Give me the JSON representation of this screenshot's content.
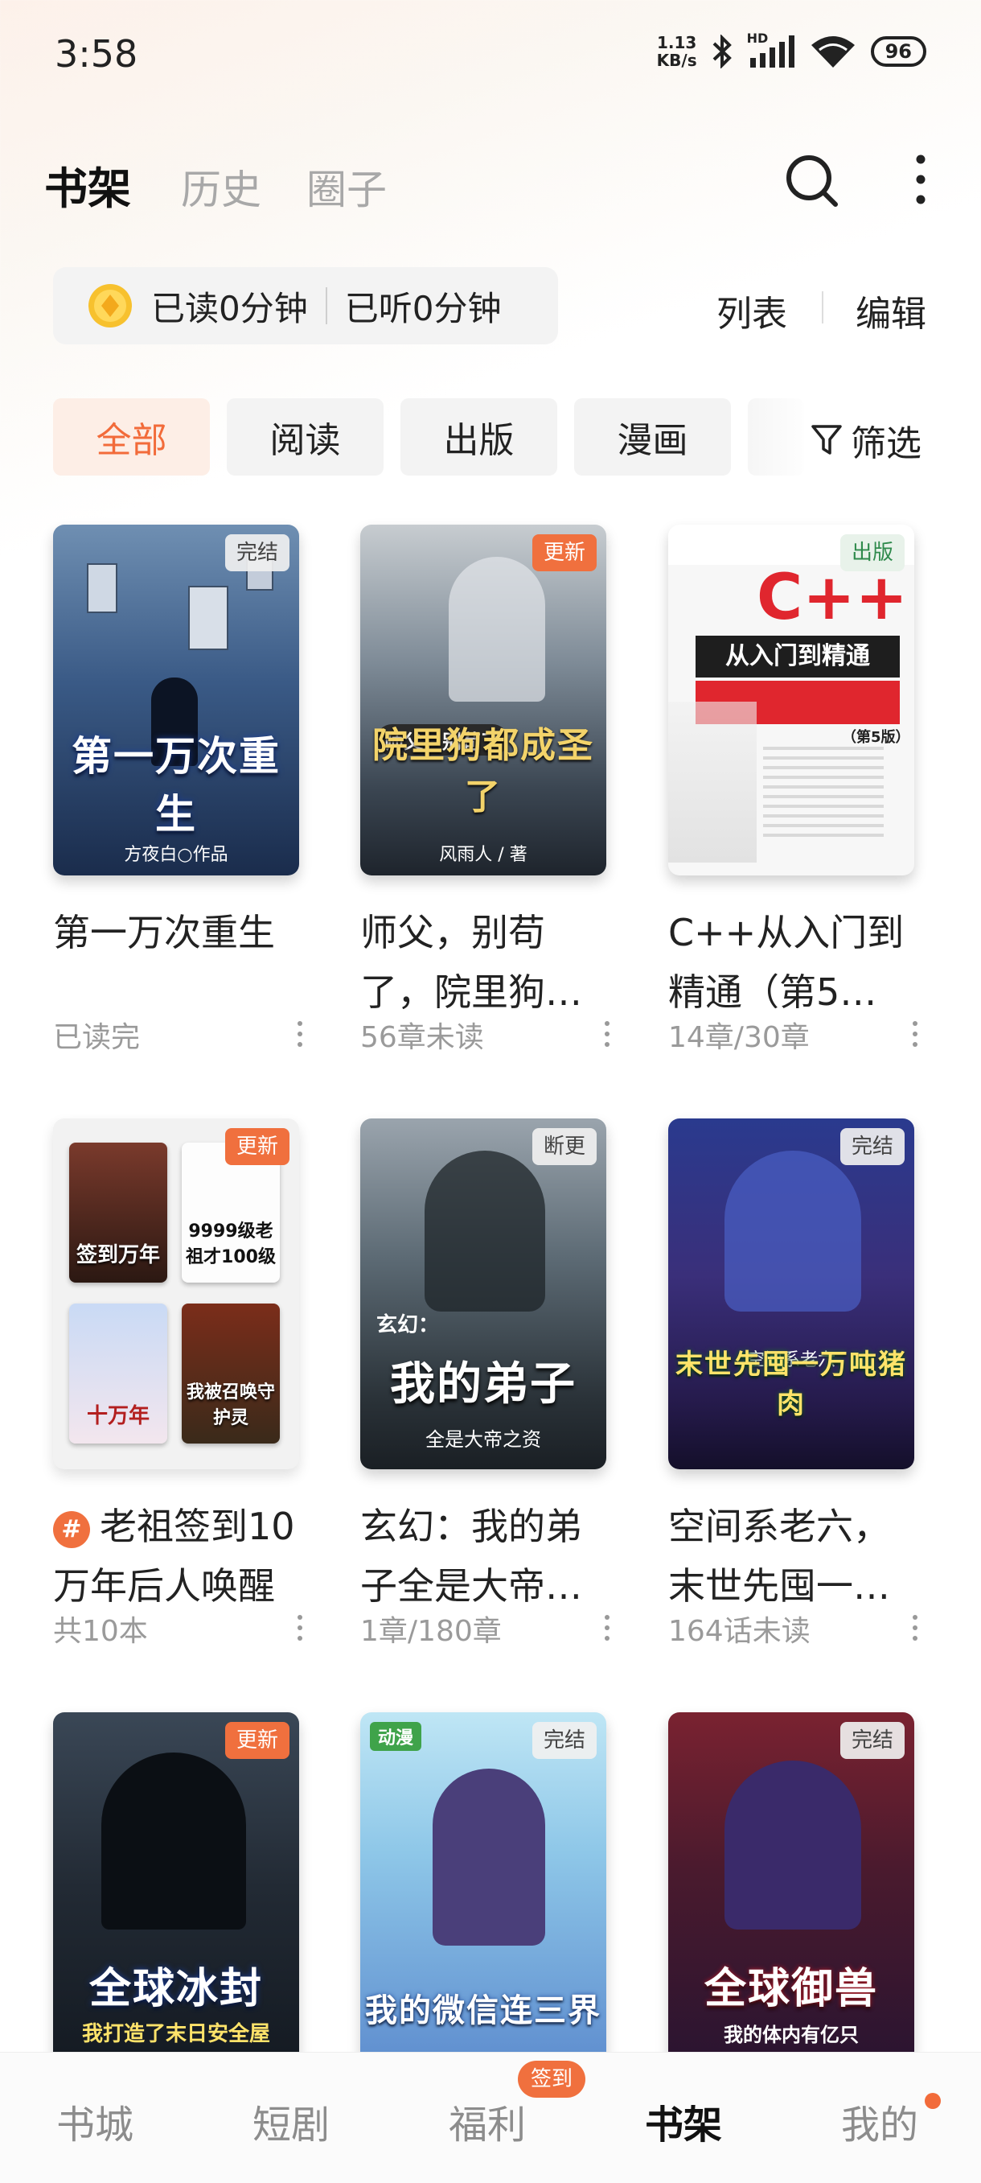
{
  "status_bar": {
    "time": "3:58",
    "net_speed_value": "1.13",
    "net_speed_unit": "KB/s",
    "battery": "96",
    "network_label": "HD"
  },
  "header": {
    "tabs": [
      {
        "label": "书架",
        "active": true
      },
      {
        "label": "历史",
        "active": false
      },
      {
        "label": "圈子",
        "active": false
      }
    ]
  },
  "stats": {
    "read": "已读0分钟",
    "listened": "已听0分钟",
    "list_label": "列表",
    "edit_label": "编辑"
  },
  "filters": {
    "chips": [
      "全部",
      "阅读",
      "出版",
      "漫画"
    ],
    "filter_label": "筛选"
  },
  "books": [
    {
      "title": "第一万次重生",
      "meta": "已读完",
      "badge": "完结",
      "cover_title": "第一万次重生",
      "cover_sub": "方夜白○作品"
    },
    {
      "title": "师父，别苟了，院里狗…",
      "meta": "56章未读",
      "badge": "更新",
      "cover_title": "院里狗都成圣了",
      "cover_top": "师父，别苟了",
      "cover_sub": "风雨人 / 著"
    },
    {
      "title": "C++从入门到精通（第5…",
      "meta": "14章/30章",
      "badge": "出版",
      "cover_title": "C++",
      "cover_sub": "从入门到精通",
      "cover_edition": "（第5版）"
    },
    {
      "title": "老祖签到10万年后人唤醒",
      "meta": "共10本",
      "badge": "更新",
      "minis": [
        "签到万年",
        "9999级老祖才100级",
        "十万年",
        "我被召唤守护灵"
      ]
    },
    {
      "title": "玄幻：我的弟子全是大帝…",
      "meta": "1章/180章",
      "badge": "断更",
      "cover_top": "玄幻：",
      "cover_title": "我的弟子",
      "cover_sub": "全是大帝之资"
    },
    {
      "title": "空间系老六，末世先囤一…",
      "meta": "164话未读",
      "badge": "完结",
      "cover_top": "空间系老六",
      "cover_title": "末世先囤一万吨猪肉"
    },
    {
      "badge": "更新",
      "cover_title": "全球冰封",
      "cover_sub": "我打造了末日安全屋"
    },
    {
      "badge": "完结",
      "cover_title": "我的微信连三界",
      "cover_top": "动漫"
    },
    {
      "badge": "完结",
      "cover_title": "全球御兽",
      "cover_sub": "我的体内有亿只"
    }
  ],
  "bottom_nav": {
    "items": [
      {
        "label": "书城",
        "active": false
      },
      {
        "label": "短剧",
        "active": false
      },
      {
        "label": "福利",
        "active": false
      },
      {
        "label": "书架",
        "active": true
      },
      {
        "label": "我的",
        "active": false
      }
    ],
    "sign_badge": "签到"
  },
  "colors": {
    "accent": "#f26b3a",
    "badge_update": "#f0703e",
    "badge_publish": "#2f8a4c"
  }
}
